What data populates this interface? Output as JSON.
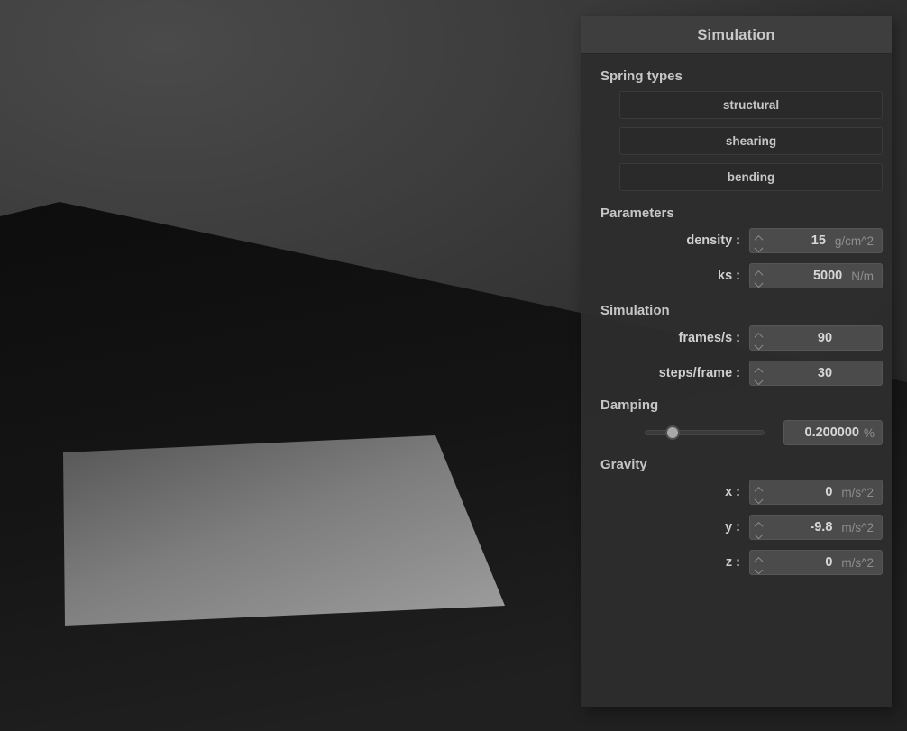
{
  "panel": {
    "title": "Simulation",
    "sections": {
      "spring_types": {
        "heading": "Spring types",
        "buttons": [
          {
            "label": "structural"
          },
          {
            "label": "shearing"
          },
          {
            "label": "bending"
          }
        ]
      },
      "parameters": {
        "heading": "Parameters",
        "fields": [
          {
            "label": "density :",
            "value": "15",
            "unit": "g/cm^2"
          },
          {
            "label": "ks :",
            "value": "5000",
            "unit": "N/m"
          }
        ]
      },
      "simulation": {
        "heading": "Simulation",
        "fields": [
          {
            "label": "frames/s :",
            "value": "90",
            "unit": ""
          },
          {
            "label": "steps/frame :",
            "value": "30",
            "unit": ""
          }
        ]
      },
      "damping": {
        "heading": "Damping",
        "slider_percent": 20,
        "value": "0.200000",
        "unit": "%"
      },
      "gravity": {
        "heading": "Gravity",
        "fields": [
          {
            "label": "x :",
            "value": "0",
            "unit": "m/s^2"
          },
          {
            "label": "y :",
            "value": "-9.8",
            "unit": "m/s^2"
          },
          {
            "label": "z :",
            "value": "0",
            "unit": "m/s^2"
          }
        ]
      }
    }
  },
  "viewport": {
    "scene_name": "cloth-simulation-3d-view",
    "colors": {
      "background_top": "#4a4a4a",
      "background_bottom": "#232323",
      "ground_plane": "#121212",
      "cloth": "#8e8e8e"
    }
  },
  "icons": {
    "spin_up": "chevron-up-icon",
    "spin_down": "chevron-down-icon"
  }
}
